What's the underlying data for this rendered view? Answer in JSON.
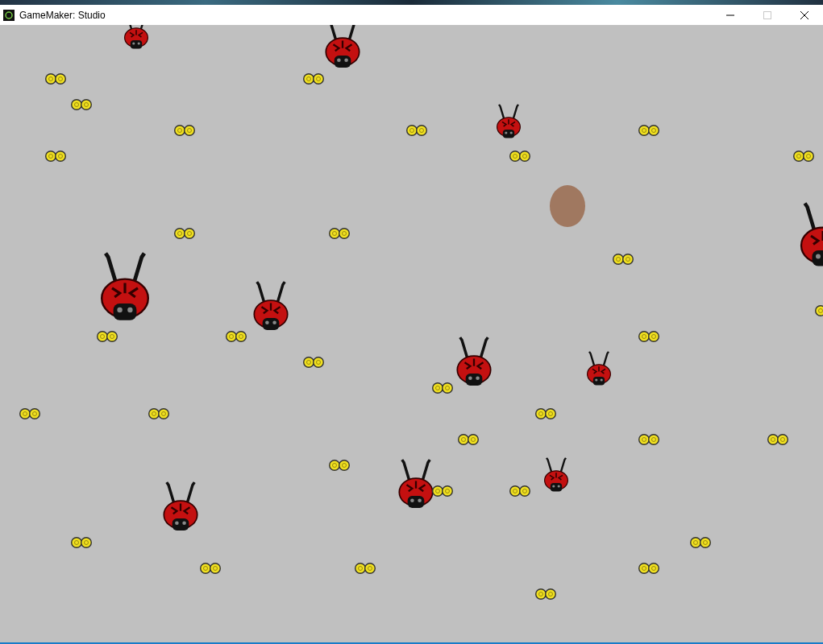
{
  "window": {
    "title": "GameMaker: Studio"
  },
  "title_buttons": [
    {
      "kind": "minimize",
      "disabled": false
    },
    {
      "kind": "maximize",
      "disabled": true
    },
    {
      "kind": "close",
      "disabled": false
    }
  ],
  "sprites": [
    {
      "kind": "bug"
    },
    {
      "kind": "bug"
    },
    {
      "kind": "bug"
    },
    {
      "kind": "bug"
    },
    {
      "kind": "bug"
    },
    {
      "kind": "bug"
    },
    {
      "kind": "bug"
    },
    {
      "kind": "bug"
    },
    {
      "kind": "bug"
    },
    {
      "kind": "bug"
    },
    {
      "kind": "bug"
    },
    {
      "kind": "coin"
    },
    {
      "kind": "coin"
    },
    {
      "kind": "coin"
    },
    {
      "kind": "coin"
    },
    {
      "kind": "coin"
    },
    {
      "kind": "coin"
    },
    {
      "kind": "coin"
    },
    {
      "kind": "coin"
    },
    {
      "kind": "coin"
    },
    {
      "kind": "coin"
    },
    {
      "kind": "coin"
    },
    {
      "kind": "coin"
    },
    {
      "kind": "coin"
    },
    {
      "kind": "coin"
    },
    {
      "kind": "coin"
    },
    {
      "kind": "coin"
    },
    {
      "kind": "coin"
    },
    {
      "kind": "coin"
    },
    {
      "kind": "coin"
    },
    {
      "kind": "coin"
    },
    {
      "kind": "coin"
    },
    {
      "kind": "coin"
    },
    {
      "kind": "coin"
    },
    {
      "kind": "coin"
    },
    {
      "kind": "coin"
    },
    {
      "kind": "coin"
    },
    {
      "kind": "coin"
    },
    {
      "kind": "coin"
    },
    {
      "kind": "coin"
    },
    {
      "kind": "coin"
    },
    {
      "kind": "coin"
    },
    {
      "kind": "coin"
    },
    {
      "kind": "coin"
    },
    {
      "kind": "player"
    }
  ]
}
